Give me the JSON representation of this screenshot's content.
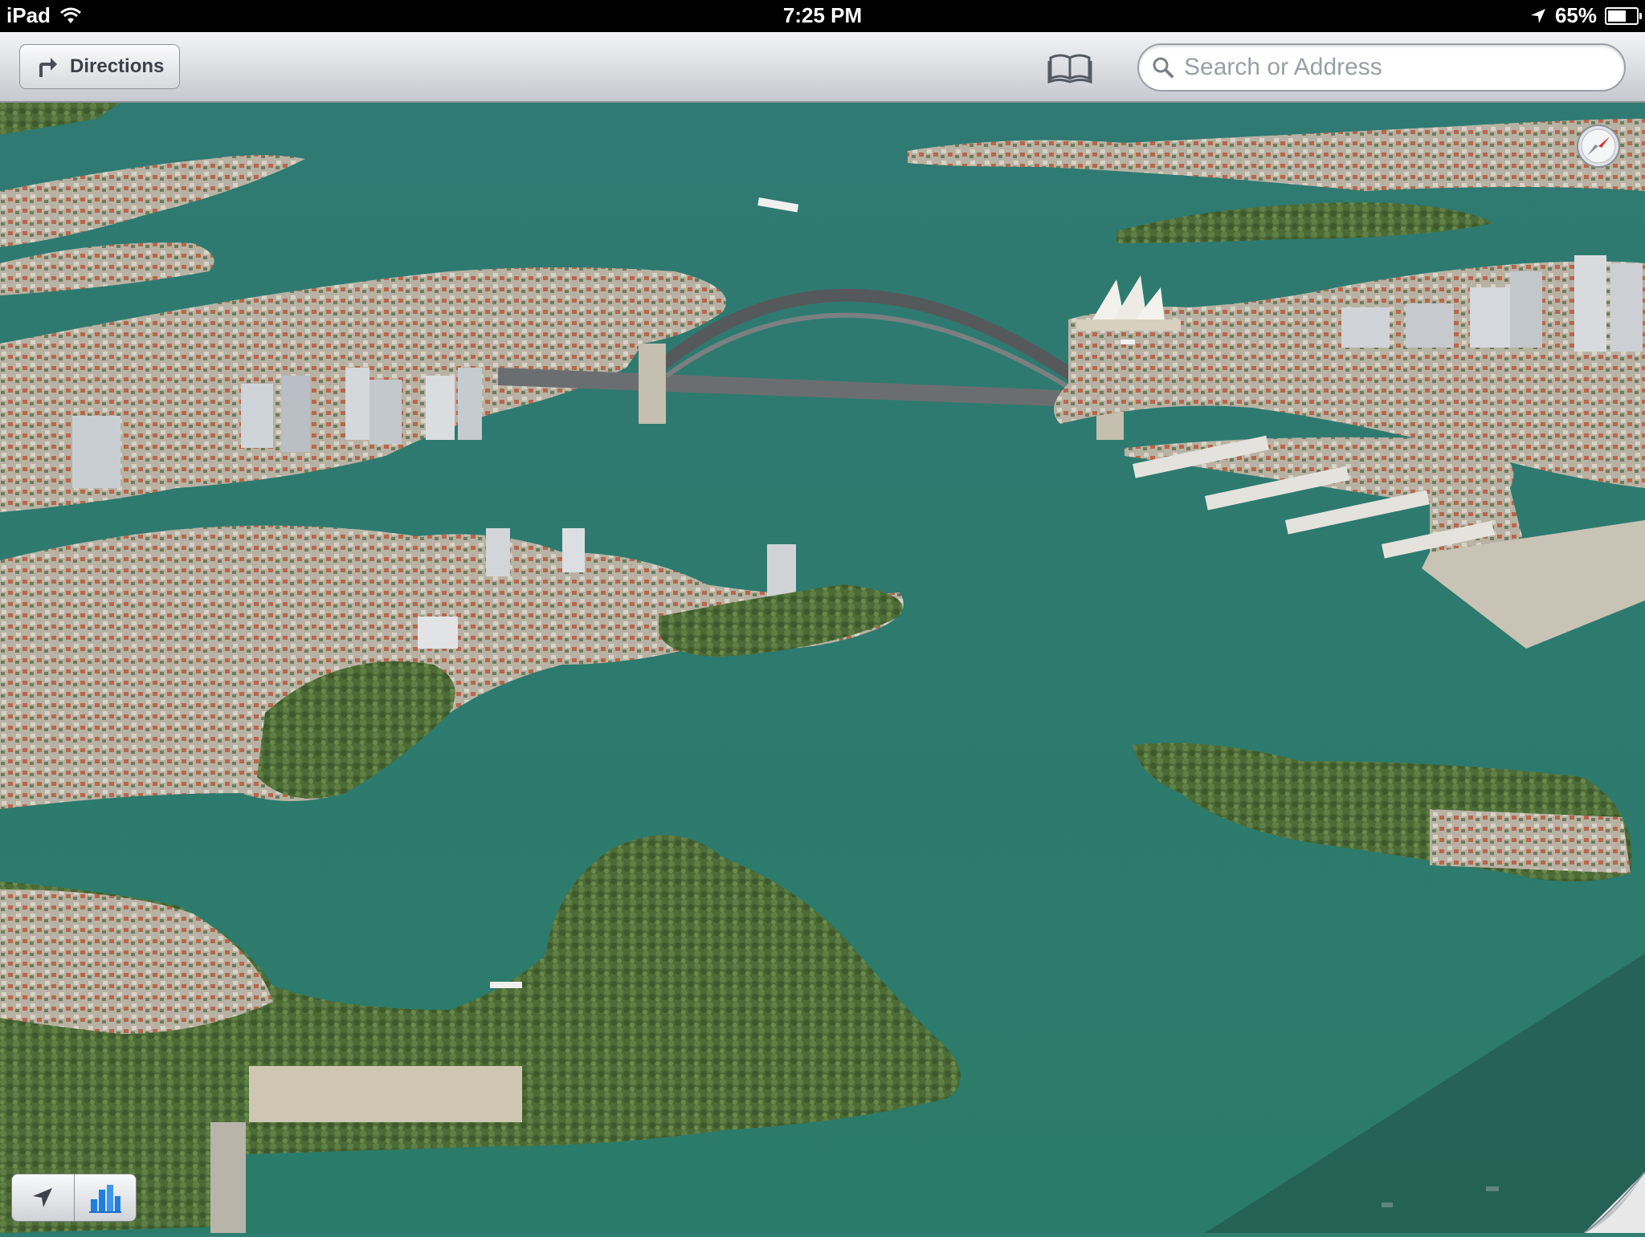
{
  "status_bar": {
    "device": "iPad",
    "time": "7:25 PM",
    "battery": "65%",
    "battery_level": 0.65
  },
  "toolbar": {
    "directions_label": "Directions",
    "search_placeholder": "Search or Address"
  },
  "icons": {
    "directions": "turn-right-arrow-icon",
    "bookmarks": "open-book-icon",
    "search": "magnifier-icon",
    "compass": "compass-icon",
    "location": "location-arrow-icon",
    "buildings": "3d-buildings-icon",
    "wifi": "wifi-icon",
    "location_status": "location-services-icon",
    "page_curl": "page-curl-icon"
  },
  "colors": {
    "water": "#2d7d70",
    "water_deep": "#24685f",
    "land": "#4f6f3a",
    "city": "#b9b3a6",
    "accent_blue": "#1e7fe0"
  }
}
